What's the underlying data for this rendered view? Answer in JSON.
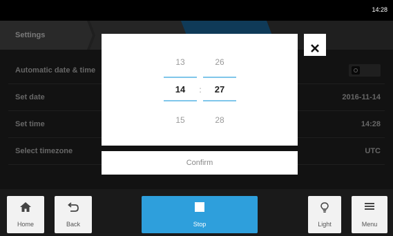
{
  "status": {
    "time": "14:28"
  },
  "header": {
    "breadcrumb_1": "Settings"
  },
  "settings": {
    "rows": [
      {
        "label": "Automatic date & time",
        "control": "toggle-off"
      },
      {
        "label": "Set date",
        "value": "2016-11-14"
      },
      {
        "label": "Set time",
        "value": "14:28"
      },
      {
        "label": "Select timezone",
        "value": "UTC"
      }
    ]
  },
  "picker": {
    "hours": {
      "prev": "13",
      "selected": "14",
      "next": "15"
    },
    "minutes": {
      "prev": "26",
      "selected": "27",
      "next": "28"
    },
    "separator": ":",
    "confirm_label": "Confirm",
    "close_icon": "close-icon"
  },
  "footer": {
    "home": "Home",
    "back": "Back",
    "stop": "Stop",
    "light": "Light",
    "menu": "Menu"
  },
  "colors": {
    "accent": "#2e9fdc",
    "active_crumb": "#1c6aa0",
    "picker_line": "#7fc6ea"
  }
}
